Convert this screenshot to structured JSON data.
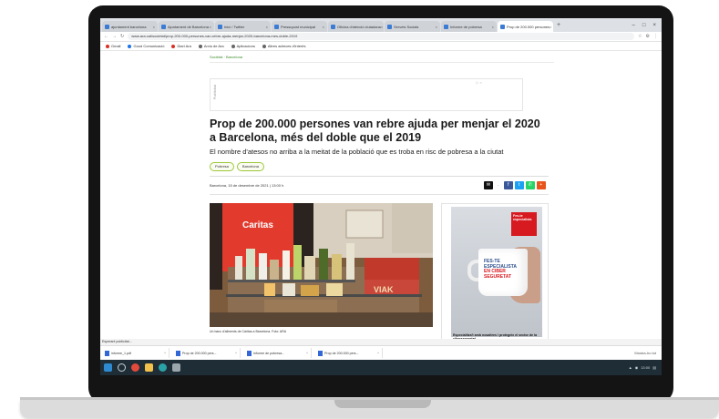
{
  "browser": {
    "tabs": [
      {
        "label": "ajuntament barcelona"
      },
      {
        "label": "Ajuntament de Barcelona"
      },
      {
        "label": "Inici / Twitter"
      },
      {
        "label": "Pressupost municipal"
      },
      {
        "label": "Oficina d'atenció ciutadana"
      },
      {
        "label": "Serveis Socials"
      },
      {
        "label": "Informe de pobresa"
      },
      {
        "label": "Prop de 200.000 persones"
      }
    ],
    "url": "www.ara.cat/societat/prop-200-000-persones-van-rebre-ajuda-menjar-2020-barcelona-mes-doble-2019",
    "bookmarks": [
      "Gmail",
      "Good Comunicació",
      "Diari Ara",
      "Arxiu de Ara",
      "Aplicacions",
      "Altres adreces d'interès"
    ]
  },
  "page": {
    "breadcrumb": "Societat · Barcelona",
    "ad_label": "Publicitat",
    "headline": "Prop de 200.000 persones van rebre ajuda per menjar el 2020 a Barcelona, més del doble que el 2019",
    "subhead": "El nombre d'atesos no arriba a la meitat de la població que es troba en risc de pobresa a la ciutat",
    "tags": [
      "Pobresa",
      "Barcelona"
    ],
    "dateline": "Barcelona, 15 de desembre de 2021 | 13:00 h",
    "photo_caption": "Un banc d'aliments de Càritas a Barcelona. Foto: ARA",
    "photo_brand": "Caritas",
    "sidead": {
      "logo": "Fes-te especialista",
      "mug_line1": "FES-TE",
      "mug_line2": "ESPECIALISTA",
      "mug_line3": "EN CIBER",
      "mug_line4": "SEGURETAT",
      "text": "Especialitza't amb nosaltres i protegeix el sector de la ciberseguretat."
    }
  },
  "status": {
    "text": "Esperant publicitat..."
  },
  "downloads": [
    {
      "label": "informe_1.pdf"
    },
    {
      "label": "Prop de 200.000 pers..."
    },
    {
      "label": "Informe de pobresa..."
    },
    {
      "label": "Prop de 200.000 pers..."
    }
  ],
  "downloads_more": "Mostra-ho tot",
  "tray_time": "13:00",
  "colors": {
    "accent_green": "#9cc93a",
    "brand_red": "#d71920",
    "taskbar": "#1f2d36"
  }
}
